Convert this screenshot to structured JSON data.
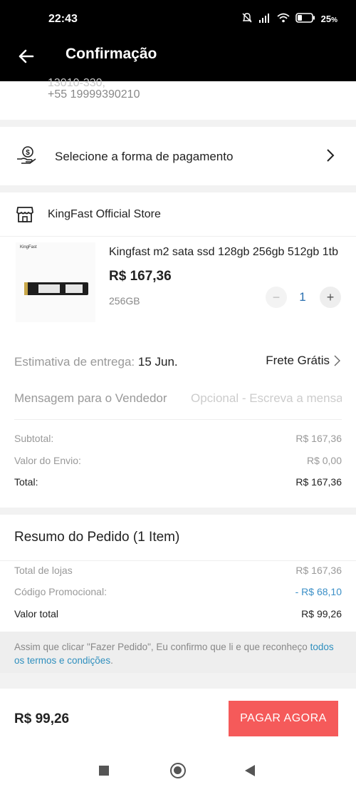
{
  "status_bar": {
    "time": "22:43",
    "battery": "25"
  },
  "app_bar": {
    "title": "Confirmação"
  },
  "address": {
    "partial_line": "13010-330,",
    "phone": "+55 19999390210"
  },
  "payment": {
    "label": "Selecione a forma de pagamento"
  },
  "store": {
    "name": "KingFast Official Store",
    "product": {
      "image_brand": "KingFast",
      "title": "Kingfast m2 sata ssd 128gb 256gb 512gb 1tb",
      "price": "R$ 167,36",
      "variant": "256GB",
      "qty_minus": "−",
      "quantity": "1",
      "qty_plus": "+"
    },
    "delivery": {
      "label": "Estimativa de entrega:",
      "date": "15 Jun.",
      "shipping": "Frete Grátis"
    },
    "message": {
      "label": "Mensagem para o Vendedor",
      "placeholder": "Opcional - Escreva a mensagem"
    },
    "summary": [
      {
        "label": "Subtotal:",
        "value": "R$ 167,36"
      },
      {
        "label": "Valor do Envio:",
        "value": "R$ 0,00"
      },
      {
        "label": "Total:",
        "value": "R$ 167,36"
      }
    ]
  },
  "order_summary": {
    "title": "Resumo do Pedido (1 Item)",
    "rows": [
      {
        "label": "Total de lojas",
        "value": "R$ 167,36"
      },
      {
        "label": "Código Promocional:",
        "value": "- R$ 68,10"
      },
      {
        "label": "Valor total",
        "value": "R$ 99,26"
      }
    ],
    "terms_text": "Assim que clicar \"Fazer Pedido\", Eu confirmo que li e que reconheço",
    "terms_link": "todos os termos e condições",
    "terms_end": "."
  },
  "footer": {
    "total": "R$ 99,26",
    "pay_button": "PAGAR AGORA"
  },
  "colors": {
    "accent": "#f55a5a",
    "link": "#2f8fbe",
    "header": "#000000"
  }
}
